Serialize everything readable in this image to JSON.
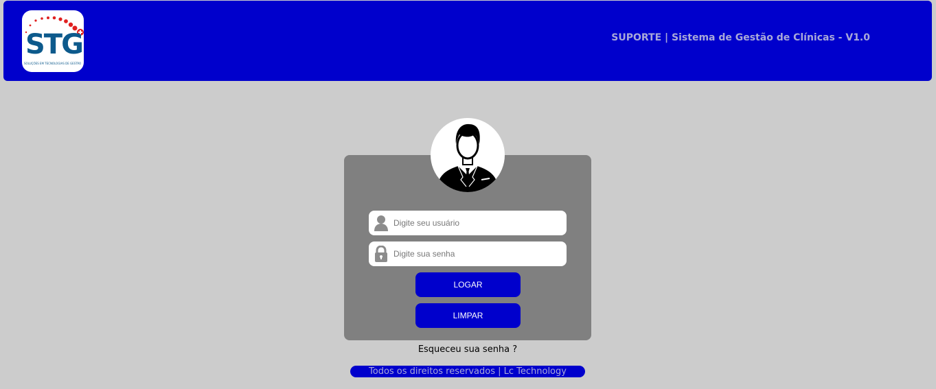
{
  "header": {
    "logo_text": "STG",
    "logo_subtitle": "SOLUÇÕES EM TECNOLOGIAS DE GESTÃO",
    "logo_icon": "medical-cross-icon",
    "title": "SUPORTE | Sistema de Gestão de Clínicas - V1.0",
    "background_color": "#0000cc"
  },
  "login": {
    "avatar_icon": "businessman-avatar-icon",
    "username": {
      "icon": "user-icon",
      "placeholder": "Digite seu usuário",
      "value": ""
    },
    "password": {
      "icon": "padlock-icon",
      "placeholder": "Digite sua senha",
      "value": ""
    },
    "login_button": "LOGAR",
    "clear_button": "LIMPAR",
    "forgot_password": "Esqueceu sua senha ?",
    "panel_color": "#808080",
    "button_color": "#0000cc"
  },
  "footer": {
    "text": "Todos os direitos reservados | Lc Technology"
  }
}
